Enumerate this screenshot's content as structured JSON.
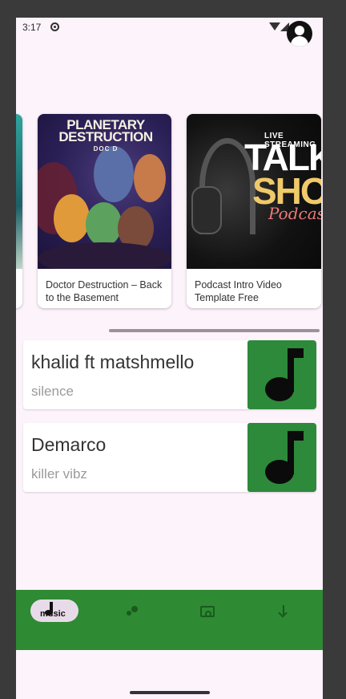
{
  "status_bar": {
    "time": "3:17"
  },
  "carousel": {
    "cards": [
      {
        "title": "Doctor Destruction – Back to the Basement",
        "cover_text": "Planetary Destruction",
        "cover_subtext": "DOC D"
      },
      {
        "title": "Podcast Intro Video Template Free",
        "cover_live": "LIVE STREAMING",
        "cover_talk": "TALK",
        "cover_show": "SHOW",
        "cover_podcast": "Podcast"
      }
    ]
  },
  "tracks": [
    {
      "title": "khalid ft matshmello",
      "artist": "silence"
    },
    {
      "title": "Demarco",
      "artist": "killer vibz"
    }
  ],
  "bottom_nav": {
    "items": [
      {
        "label": "music",
        "icon": "music-note-icon",
        "active": true
      },
      {
        "label": "",
        "icon": "dots-icon",
        "active": false
      },
      {
        "label": "",
        "icon": "podcast-icon",
        "active": false
      },
      {
        "label": "",
        "icon": "download-icon",
        "active": false
      }
    ]
  },
  "colors": {
    "background": "#fdf3fb",
    "nav_green": "#2e8a33",
    "art_green": "#2d8a3a",
    "active_pill": "#e8dbe9"
  }
}
